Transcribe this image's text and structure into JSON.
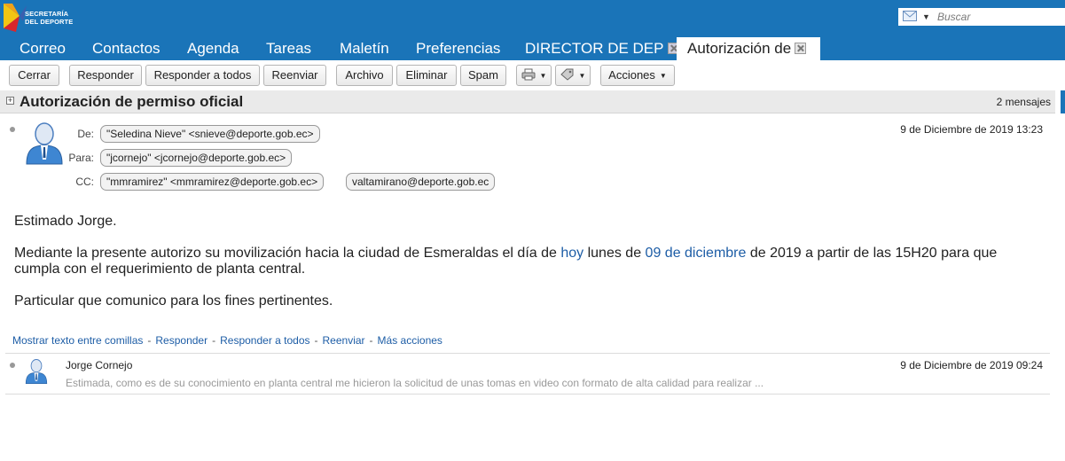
{
  "header": {
    "logo_text": [
      "SECRETARÍA",
      "DEL DEPORTE"
    ],
    "search_placeholder": "Buscar",
    "colors": {
      "bar": "#1a74b8",
      "link": "#1d5da6"
    }
  },
  "tabs": [
    {
      "label": "Correo"
    },
    {
      "label": "Contactos"
    },
    {
      "label": "Agenda"
    },
    {
      "label": "Tareas"
    },
    {
      "label": "Maletín"
    },
    {
      "label": "Preferencias"
    },
    {
      "label": "DIRECTOR DE DEP",
      "closable": true
    },
    {
      "label": "Autorización de",
      "closable": true,
      "active": true
    }
  ],
  "toolbar": {
    "cerrar": "Cerrar",
    "responder": "Responder",
    "responder_todos": "Responder a todos",
    "reenviar": "Reenviar",
    "archivo": "Archivo",
    "eliminar": "Eliminar",
    "spam": "Spam",
    "acciones": "Acciones",
    "icons": [
      "printer-icon",
      "tag-icon"
    ]
  },
  "conversation": {
    "title": "Autorización de permiso oficial",
    "count": "2 mensajes"
  },
  "message1": {
    "labels": {
      "from": "De:",
      "to": "Para:",
      "cc": "CC:"
    },
    "from": "\"Seledina Nieve\" <snieve@deporte.gob.ec>",
    "to": "\"jcornejo\" <jcornejo@deporte.gob.ec>",
    "cc": [
      "\"mmramirez\" <mmramirez@deporte.gob.ec>",
      "valtamirano@deporte.gob.ec"
    ],
    "date": "9 de Diciembre de 2019 13:23",
    "greeting": "Estimado Jorge.",
    "p1_a": "Mediante la presente autorizo su movilización hacia la ciudad de Esmeraldas el día de ",
    "p1_link1": "hoy",
    "p1_b": " lunes de ",
    "p1_link2": "09 de diciembre",
    "p1_c": " de 2019 a partir de las 15H20 para que",
    "p1_line2": "cumpla con el requerimiento de planta central.",
    "p2": "Particular que comunico para los fines pertinentes.",
    "actions": {
      "show_quoted": "Mostrar texto entre comillas",
      "reply": "Responder",
      "reply_all": "Responder a todos",
      "forward": "Reenviar",
      "more": "Más acciones",
      "sep": "-"
    }
  },
  "message2": {
    "sender": "Jorge Cornejo",
    "date": "9 de Diciembre de 2019 09:24",
    "snippet": "Estimada, como es de su conocimiento en planta central me hicieron la solicitud de unas tomas en video con formato de alta calidad para realizar ..."
  }
}
